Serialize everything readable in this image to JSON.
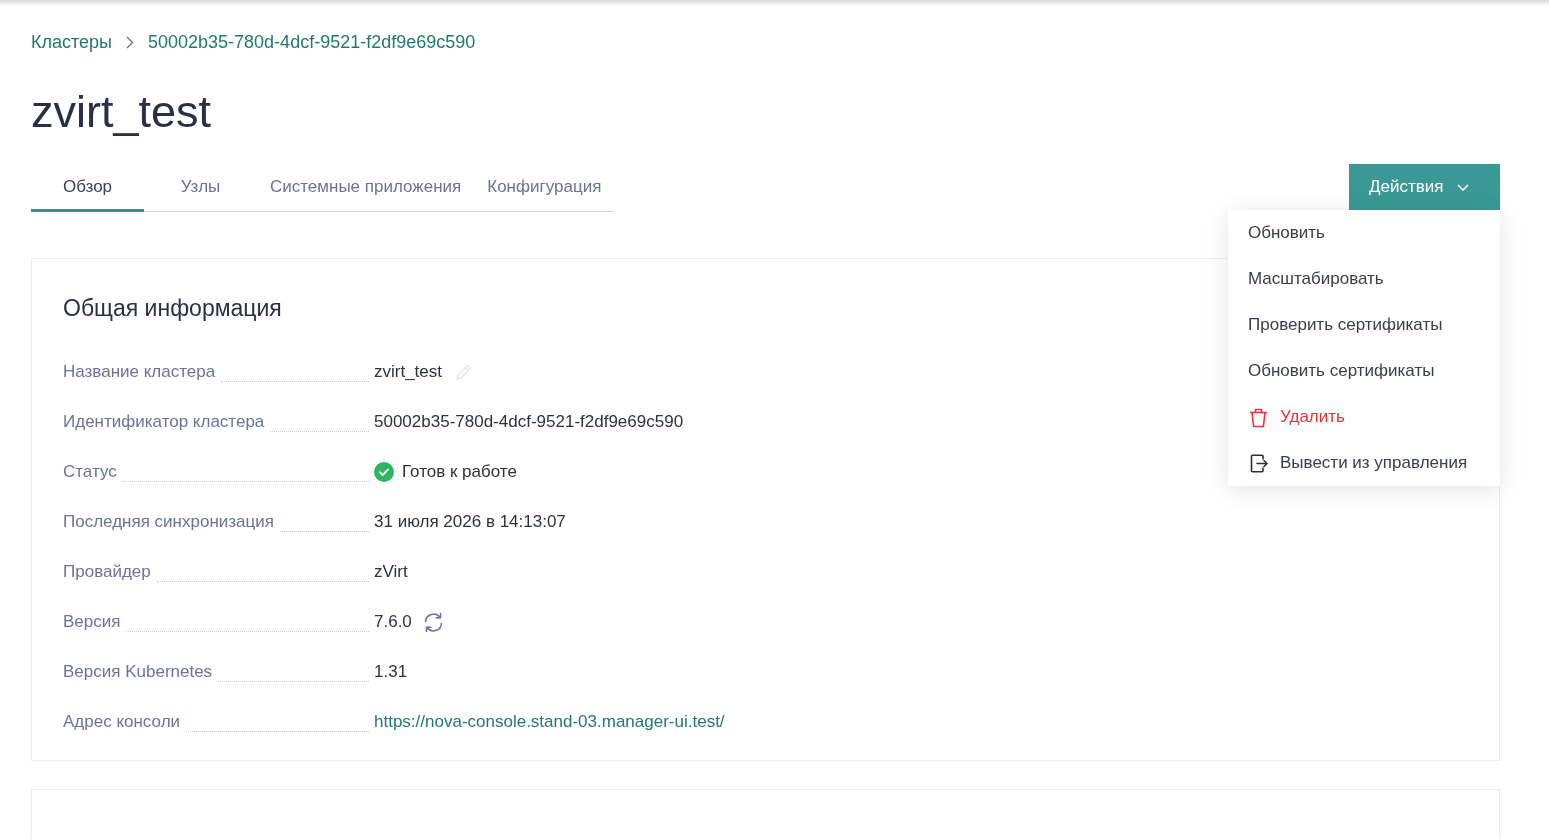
{
  "breadcrumbs": [
    {
      "label": "Кластеры"
    },
    {
      "label": "50002b35-780d-4dcf-9521-f2df9e69c590"
    }
  ],
  "title": "zvirt_test",
  "tabs": [
    {
      "label": "Обзор",
      "selected": true
    },
    {
      "label": "Узлы",
      "selected": false
    },
    {
      "label": "Системные приложения",
      "selected": false
    },
    {
      "label": "Конфигурация",
      "selected": false
    }
  ],
  "actions_button": {
    "label": "Действия",
    "expanded": true
  },
  "actions_menu": [
    {
      "label": "Обновить",
      "kind": "plain"
    },
    {
      "label": "Масштабировать",
      "kind": "plain"
    },
    {
      "label": "Проверить сертификаты",
      "kind": "plain"
    },
    {
      "label": "Обновить сертификаты",
      "kind": "plain"
    },
    {
      "label": "Удалить",
      "kind": "danger"
    },
    {
      "label": "Вывести из управления",
      "kind": "exit"
    }
  ],
  "general_info": {
    "title": "Общая информация",
    "fields": [
      {
        "label": "Название кластера",
        "value": "zvirt_test",
        "kind": "editable"
      },
      {
        "label": "Идентификатор кластера",
        "value": "50002b35-780d-4dcf-9521-f2df9e69c590",
        "kind": "text"
      },
      {
        "label": "Статус",
        "value": "Готов к работе",
        "kind": "status"
      },
      {
        "label": "Последняя синхронизация",
        "value": "31 июля 2026 в 14:13:07",
        "kind": "text"
      },
      {
        "label": "Провайдер",
        "value": "zVirt",
        "kind": "text"
      },
      {
        "label": "Версия",
        "value": "7.6.0",
        "kind": "refreshable"
      },
      {
        "label": "Версия Kubernetes",
        "value": "1.31",
        "kind": "text"
      },
      {
        "label": "Адрес консоли",
        "value": "https://nova-console.stand-03.manager-ui.test/",
        "kind": "link"
      }
    ]
  }
}
